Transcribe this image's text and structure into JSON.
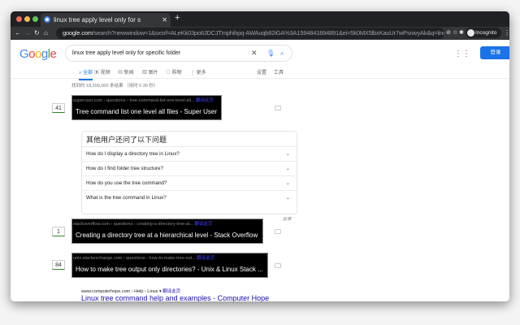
{
  "browser": {
    "tab_title": "linux tree apply level only for s",
    "url_domain": "google.com",
    "url_rest": "/search?newwindow=1&sxsrf=ALeKk03po8JDCJTmphihpq-AWAuqb82iGA%3A1594841894891&ei=5k0MX5lbxKauUr7wPsnivyAk&q=linux+tree+...",
    "profile": "Incognito"
  },
  "google": {
    "logo": "Google",
    "query": "linux tree apply level only for specific folder",
    "login": "登录",
    "tabs": [
      "全部",
      "视频",
      "新闻",
      "图片",
      "购物",
      "更多"
    ],
    "settings": "设置",
    "tools": "工具",
    "stats": "找到约 18,200,000 条结果 （用时 0.39 秒）"
  },
  "results": [
    {
      "count": "41",
      "url": "superuser.com › questions › tree-command-list-one-level-all...",
      "translate": "翻译此页",
      "title": "Tree command list one level all files - Super User"
    },
    {
      "count": "1",
      "url": "stackoverflow.com › questions › creating-a-directory-tree-at...",
      "translate": "翻译此页",
      "title": "Creating a directory tree at a hierarchical level - Stack Overflow"
    },
    {
      "count": "84",
      "url": "unix.stackexchange.com › questions › how-to-make-tree-out...",
      "translate": "翻译此页",
      "title": "How to make tree output only directories? - Unix & Linux Stack ..."
    }
  ],
  "paa": {
    "heading": "其他用户还问了以下问题",
    "questions": [
      "How do I display a directory tree in Linux?",
      "How do I find folder tree structure?",
      "How do you use the tree command?",
      "What is the tree command in Linux?"
    ],
    "feedback": "反馈"
  },
  "last": {
    "url": "www.computerhope.com › Help › Linux ▾ ",
    "translate": "翻译此页",
    "title": "Linux tree command help and examples - Computer Hope"
  }
}
